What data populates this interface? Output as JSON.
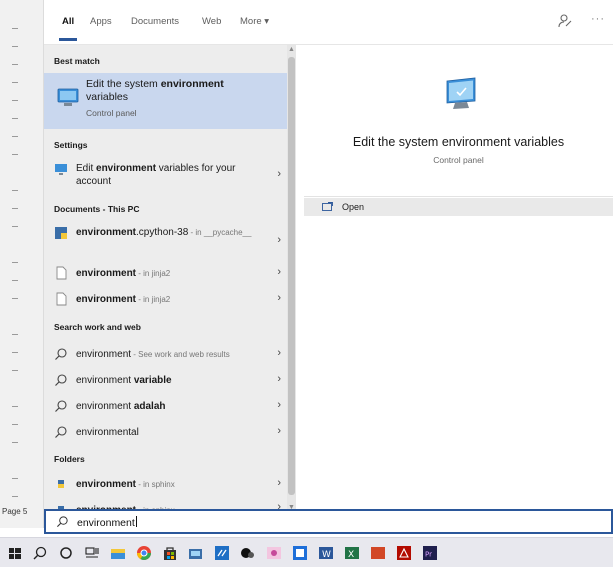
{
  "background": {
    "page_label": "Page 5"
  },
  "filter_tabs": [
    {
      "label": "All"
    },
    {
      "label": "Apps"
    },
    {
      "label": "Documents"
    },
    {
      "label": "Web"
    },
    {
      "label": "More ▾"
    }
  ],
  "results": {
    "best_match_header": "Best match",
    "best_match": {
      "title_pre": "Edit the system ",
      "title_bold": "environment",
      "title_post": " variables",
      "subtitle": "Control panel",
      "icon": "control-panel-icon"
    },
    "settings_header": "Settings",
    "settings": [
      {
        "pre": "Edit ",
        "bold": "environment",
        "post": " variables for your account",
        "icon": "settings-monitor-icon"
      }
    ],
    "documents_header": "Documents - This PC",
    "documents": [
      {
        "bold": "environment",
        "post": ".cpython-38",
        "dim": " - in __pycache__",
        "icon": "python-file-icon"
      },
      {
        "bold": "environment",
        "post": "",
        "dim": " - in jinja2",
        "icon": "file-icon"
      },
      {
        "bold": "environment",
        "post": "",
        "dim": " - in jinja2",
        "icon": "file-icon"
      }
    ],
    "web_header": "Search work and web",
    "web": [
      {
        "pre": "environment",
        "bold": "",
        "dim": " - See work and web results",
        "icon": "search-icon"
      },
      {
        "pre": "environment ",
        "bold": "variable",
        "dim": "",
        "icon": "search-icon"
      },
      {
        "pre": "environment ",
        "bold": "adalah",
        "dim": "",
        "icon": "search-icon"
      },
      {
        "pre": "environmental",
        "bold": "",
        "dim": "",
        "icon": "search-icon"
      }
    ],
    "folders_header": "Folders",
    "folders": [
      {
        "bold": "environment",
        "dim": " - in sphinx",
        "icon": "python-folder-icon"
      },
      {
        "bold": "environment",
        "dim": " - in sphinx",
        "icon": "python-folder-icon"
      }
    ]
  },
  "preview": {
    "title": "Edit the system environment variables",
    "subtitle": "Control panel",
    "actions": [
      {
        "label": "Open",
        "icon": "open-icon"
      }
    ]
  },
  "search": {
    "value": "environment"
  },
  "taskbar": {
    "items": [
      "windows-start-icon",
      "search-icon",
      "cortana-icon",
      "task-view-icon",
      "file-explorer-icon",
      "chrome-icon",
      "store-icon",
      "explorer-icon",
      "vs-code-icon",
      "xbox-icon",
      "photos-icon",
      "app-icon",
      "word-icon",
      "excel-icon",
      "office-icon",
      "acrobat-icon",
      "premiere-icon"
    ]
  },
  "colors": {
    "accent": "#2b579a",
    "selected_row": "#c9d7ee",
    "list_bg": "#ededed"
  }
}
